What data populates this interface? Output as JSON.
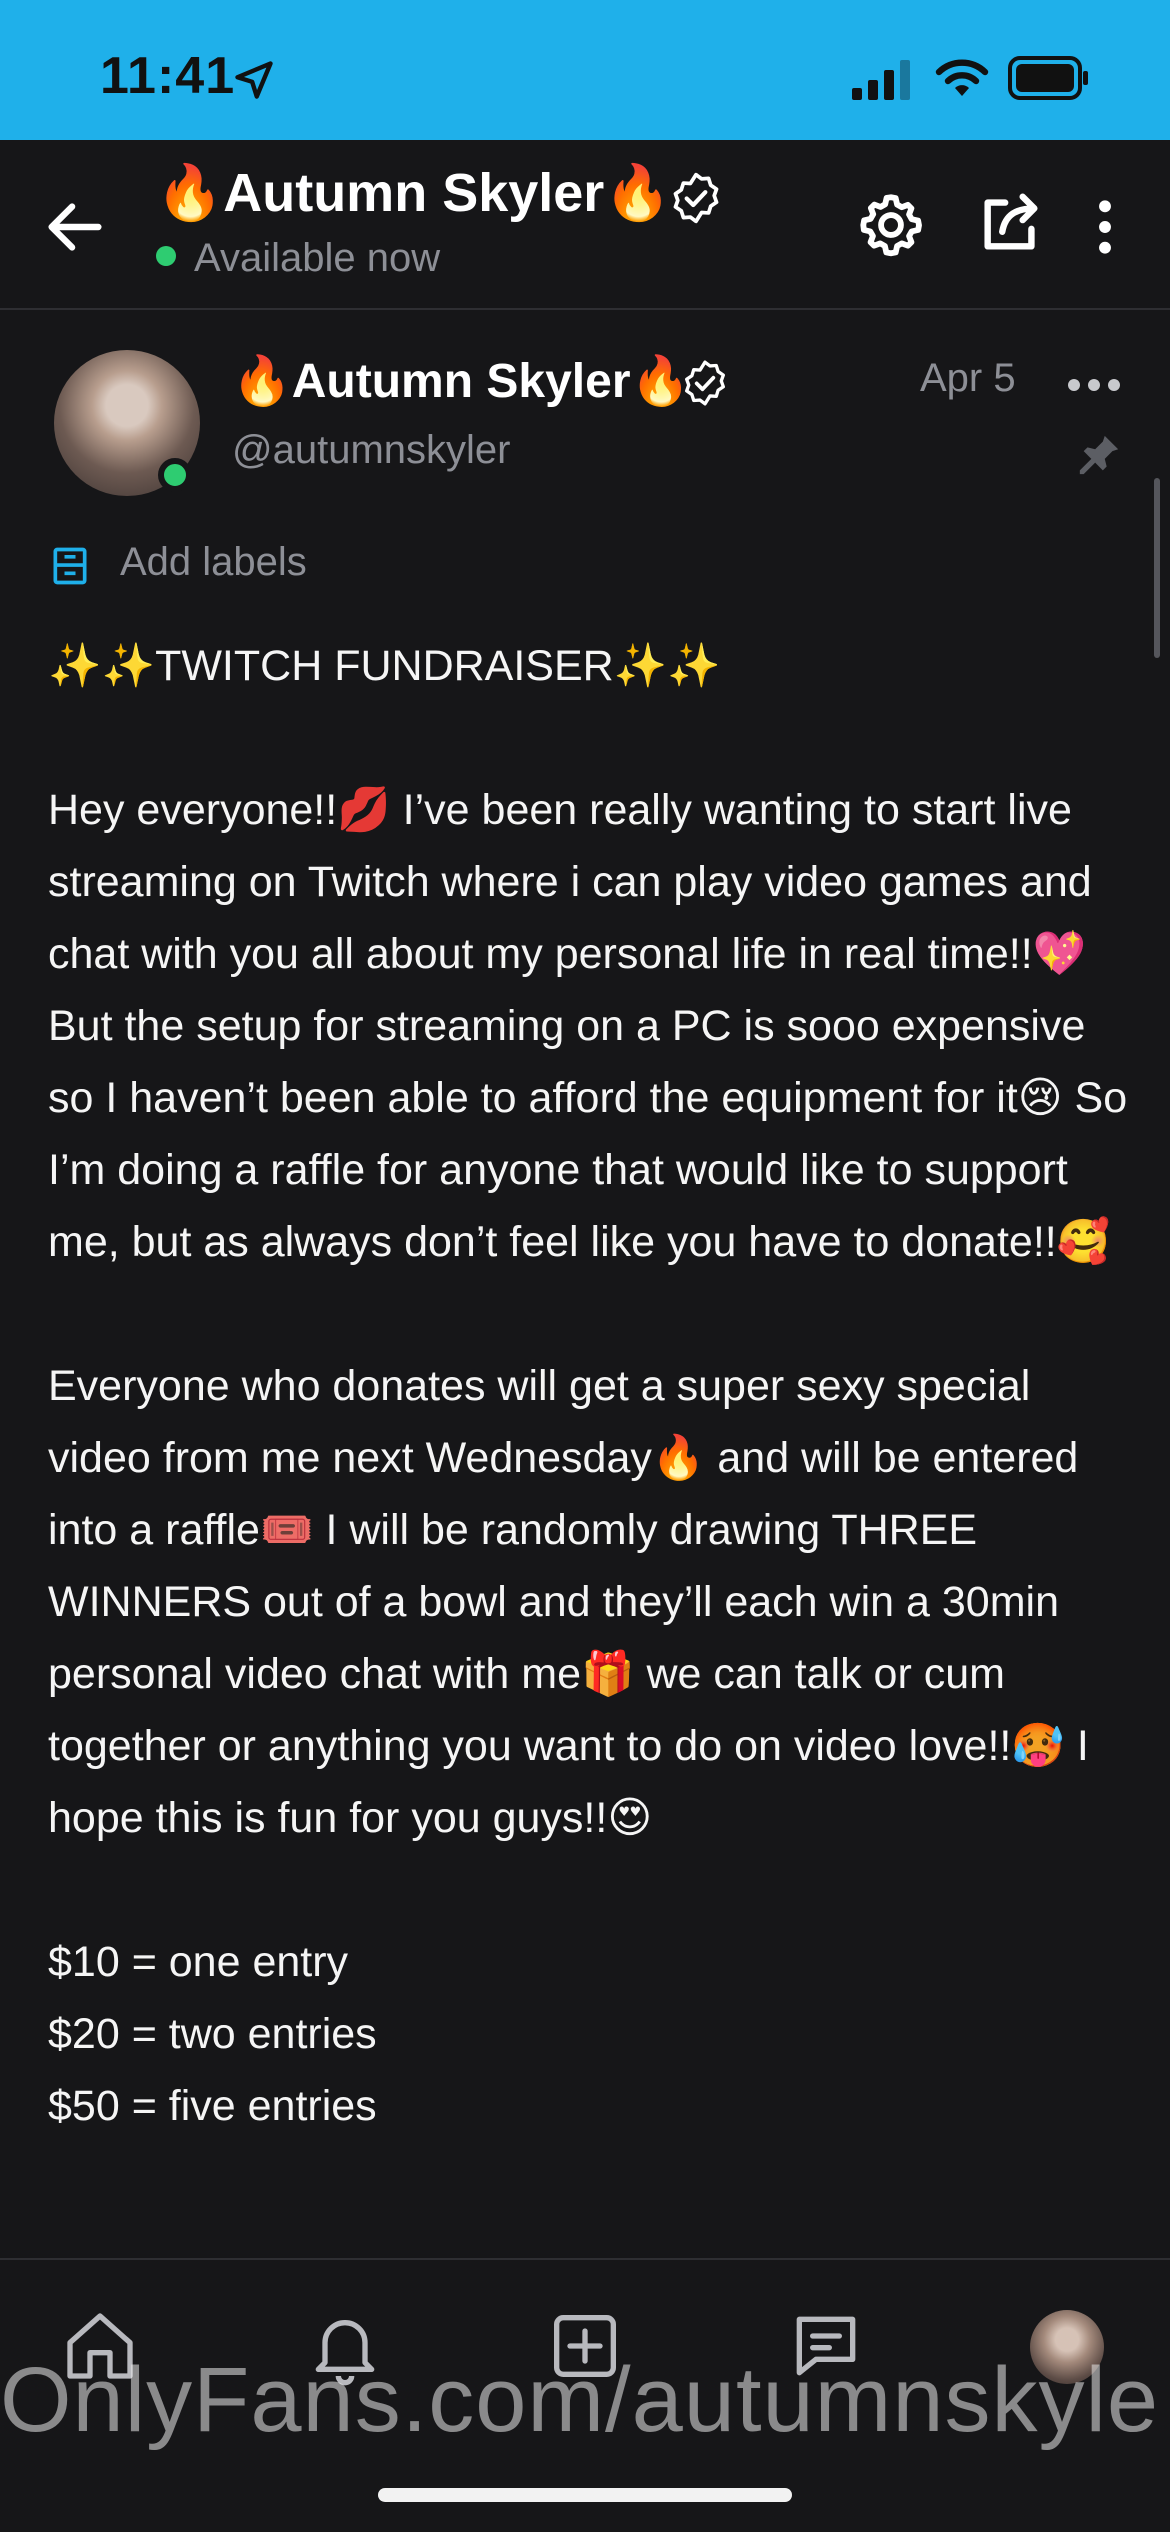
{
  "status_bar": {
    "time": "11:41"
  },
  "header": {
    "title": "🔥Autumn Skyler🔥",
    "status": "Available now"
  },
  "post": {
    "author_name": "🔥Autumn Skyler🔥",
    "handle": "@autumnskyler",
    "date": "Apr 5",
    "add_labels": "Add labels",
    "paragraphs": [
      "✨✨TWITCH FUNDRAISER✨✨",
      "Hey everyone!!💋 I’ve been really wanting to start live streaming on Twitch where i can play video games and chat with you all about my personal life in real time!!💖 But the setup for streaming on a PC is sooo expensive so I haven’t been able to afford the equipment for it😢 So I’m doing a raffle for anyone that would like to support me, but as always don’t feel like you have to donate!!🥰",
      "Everyone who donates will get a super sexy special video from me next Wednesday🔥 and will be entered into a raffle🎟️ I will be randomly drawing THREE WINNERS out of a bowl and they’ll each win a 30min personal video chat with me🎁 we can talk or cum together or anything you want to do on video love!!🥵 I hope this is fun for you guys!!😍",
      "$10 = one entry\n$20 = two entries\n$50 = five entries"
    ]
  },
  "watermark": "OnlyFans.com/autumnskyle",
  "colors": {
    "status_bar_bg": "#1fb0ea",
    "app_bg": "#161618",
    "online_green": "#2ecc71",
    "muted_text": "#8d8f96",
    "accent_blue": "#1fb0ea"
  },
  "icons": {
    "status": [
      "location-arrow-icon",
      "signal-icon",
      "wifi-icon",
      "battery-icon"
    ],
    "header": [
      "back-arrow-icon",
      "verified-icon",
      "gear-icon",
      "share-icon",
      "more-vertical-icon"
    ],
    "post": [
      "verified-icon",
      "more-horizontal-icon",
      "pin-icon",
      "label-icon"
    ],
    "nav": [
      "home-icon",
      "bell-icon",
      "add-post-icon",
      "messages-icon",
      "profile-avatar"
    ]
  }
}
